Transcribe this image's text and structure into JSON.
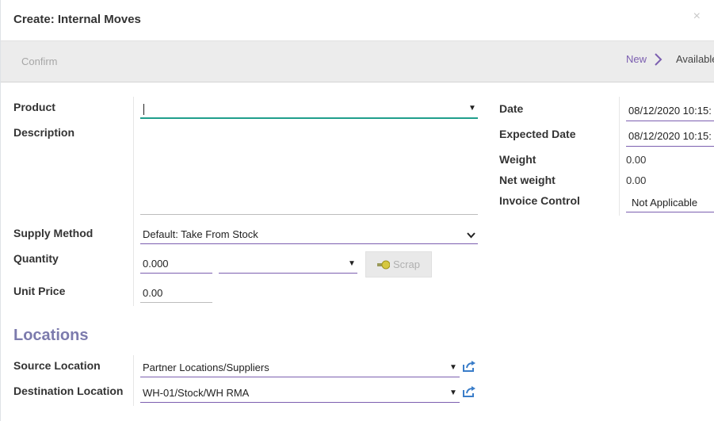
{
  "dialog": {
    "title": "Create: Internal Moves",
    "close_symbol": "×"
  },
  "statusbar": {
    "confirm_label": "Confirm",
    "stages": [
      {
        "label": "New",
        "active": true
      },
      {
        "label": "Available",
        "active": false
      }
    ]
  },
  "form": {
    "product": {
      "label": "Product",
      "value": ""
    },
    "description": {
      "label": "Description",
      "value": ""
    },
    "supply_method": {
      "label": "Supply Method",
      "value": "Default: Take From Stock"
    },
    "quantity": {
      "label": "Quantity",
      "value": "0.000",
      "uom": ""
    },
    "scrap_label": "Scrap",
    "unit_price": {
      "label": "Unit Price",
      "value": "0.00"
    },
    "date": {
      "label": "Date",
      "value": "08/12/2020 10:15:"
    },
    "expected_date": {
      "label": "Expected Date",
      "value": "08/12/2020 10:15:"
    },
    "weight": {
      "label": "Weight",
      "value": "0.00"
    },
    "net_weight": {
      "label": "Net weight",
      "value": "0.00"
    },
    "invoice_control": {
      "label": "Invoice Control",
      "value": "Not Applicable"
    }
  },
  "locations": {
    "title": "Locations",
    "source": {
      "label": "Source Location",
      "value": "Partner Locations/Suppliers"
    },
    "destination": {
      "label": "Destination Location",
      "value": "WH-01/Stock/WH RMA"
    }
  },
  "colors": {
    "accent": "#7c5fb0",
    "focus": "#1f9f8c",
    "section_title": "#7c7bad",
    "external_link": "#3a7dc9"
  },
  "icons": {
    "close": "close-icon",
    "stage_arrow": "chevron-right-icon",
    "dropdown": "caret-down-icon",
    "select": "chevron-down-icon",
    "scrap": "scrap-icon",
    "external": "external-link-icon"
  }
}
